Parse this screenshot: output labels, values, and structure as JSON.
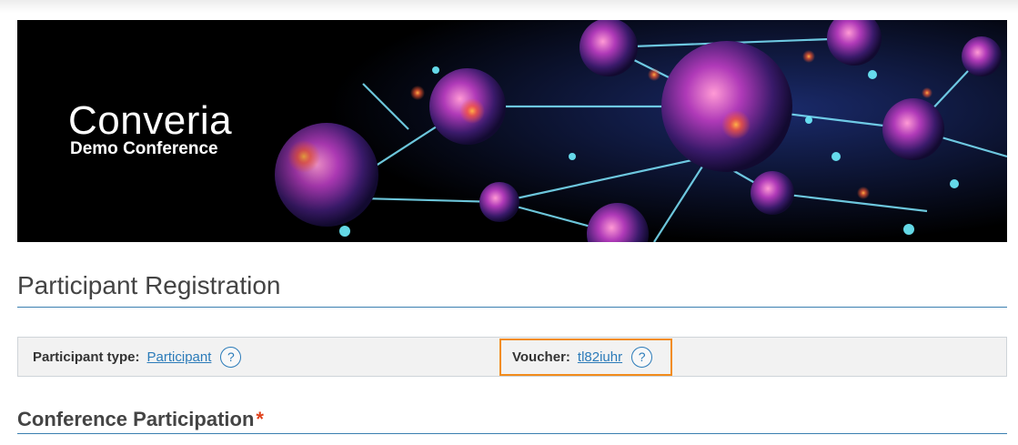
{
  "banner": {
    "brand_name": "Converia",
    "brand_subtitle": "Demo Conference"
  },
  "page": {
    "title": "Participant Registration"
  },
  "participant_info": {
    "type_label": "Participant type:",
    "type_value": "Participant",
    "voucher_label": "Voucher:",
    "voucher_value": "tl82iuhr",
    "help_glyph": "?"
  },
  "section": {
    "title": "Conference Participation",
    "required_marker": "*"
  },
  "colors": {
    "link": "#2b7bb9",
    "rule": "#3a7fb0",
    "highlight": "#f28c1c",
    "required": "#e0401a"
  }
}
